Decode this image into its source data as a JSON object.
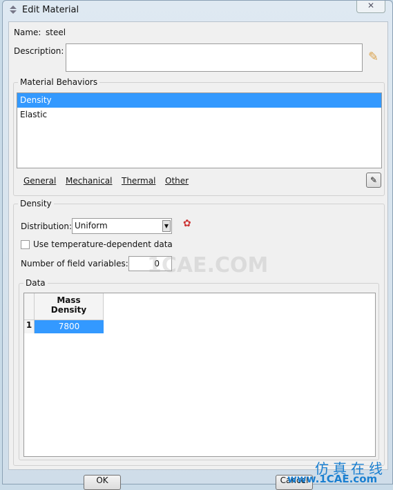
{
  "window": {
    "title": "Edit Material",
    "close_icon": "close-icon"
  },
  "name": {
    "label": "Name:",
    "value": "steel"
  },
  "description": {
    "label": "Description:",
    "value": ""
  },
  "behaviors": {
    "label": "Material Behaviors",
    "items": [
      "Density",
      "Elastic"
    ],
    "selected": "Density"
  },
  "menus": [
    "General",
    "Mechanical",
    "Thermal",
    "Other"
  ],
  "density": {
    "label": "Density",
    "distribution_label": "Distribution:",
    "distribution_value": "Uniform",
    "temp_dependent_label": "Use temperature-dependent data",
    "temp_dependent_checked": false,
    "field_vars_label": "Number of field variables:",
    "field_vars_value": "0"
  },
  "data": {
    "label": "Data",
    "columns": [
      "Mass\nDensity"
    ],
    "rows": [
      {
        "index": "1",
        "values": [
          "7800"
        ]
      }
    ]
  },
  "buttons": {
    "ok": "OK",
    "cancel": "Cancel"
  },
  "watermark": {
    "center": "1CAE.COM",
    "corner_cn": "仿真在线",
    "corner_url": "www.1CAE.com"
  },
  "colors": {
    "selection": "#3399ff",
    "watermark": "#1a7fd0"
  }
}
